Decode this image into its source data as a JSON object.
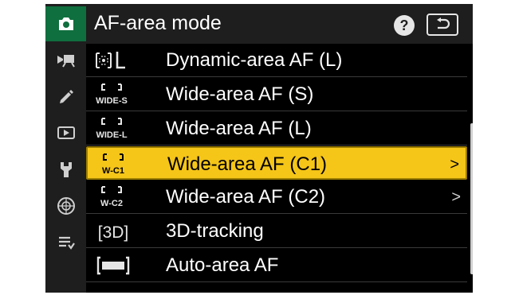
{
  "header": {
    "title": "AF-area mode",
    "help_label": "?"
  },
  "rail": {
    "items": [
      {
        "icon": "camera-icon",
        "active": true
      },
      {
        "icon": "movie-camera-icon",
        "active": false
      },
      {
        "icon": "pencil-icon",
        "active": false
      },
      {
        "icon": "playback-icon",
        "active": false
      },
      {
        "icon": "wrench-icon",
        "active": false
      },
      {
        "icon": "network-icon",
        "active": false
      },
      {
        "icon": "my-menu-icon",
        "active": false
      }
    ]
  },
  "list": {
    "items": [
      {
        "icon": "dynamic-area-l-icon",
        "label": "Dynamic-area AF (L)",
        "has_submenu": false,
        "selected": false
      },
      {
        "icon": "wide-area-s-icon",
        "icon_text": "WIDE-S",
        "label": "Wide-area AF (S)",
        "has_submenu": false,
        "selected": false
      },
      {
        "icon": "wide-area-l-icon",
        "icon_text": "WIDE-L",
        "label": "Wide-area AF (L)",
        "has_submenu": false,
        "selected": false
      },
      {
        "icon": "wide-area-c1-icon",
        "icon_text": "W-C1",
        "label": "Wide-area AF (C1)",
        "has_submenu": true,
        "selected": true
      },
      {
        "icon": "wide-area-c2-icon",
        "icon_text": "W-C2",
        "label": "Wide-area AF (C2)",
        "has_submenu": true,
        "selected": false
      },
      {
        "icon": "3d-tracking-icon",
        "icon_text": "[3D]",
        "label": "3D-tracking",
        "has_submenu": false,
        "selected": false
      },
      {
        "icon": "auto-area-icon",
        "label": "Auto-area AF",
        "has_submenu": false,
        "selected": false
      }
    ],
    "chevron": ">"
  },
  "colors": {
    "active_tab": "#0f6f3e",
    "selection": "#f5c518",
    "panel": "#1e1e1e",
    "background": "#000000"
  }
}
